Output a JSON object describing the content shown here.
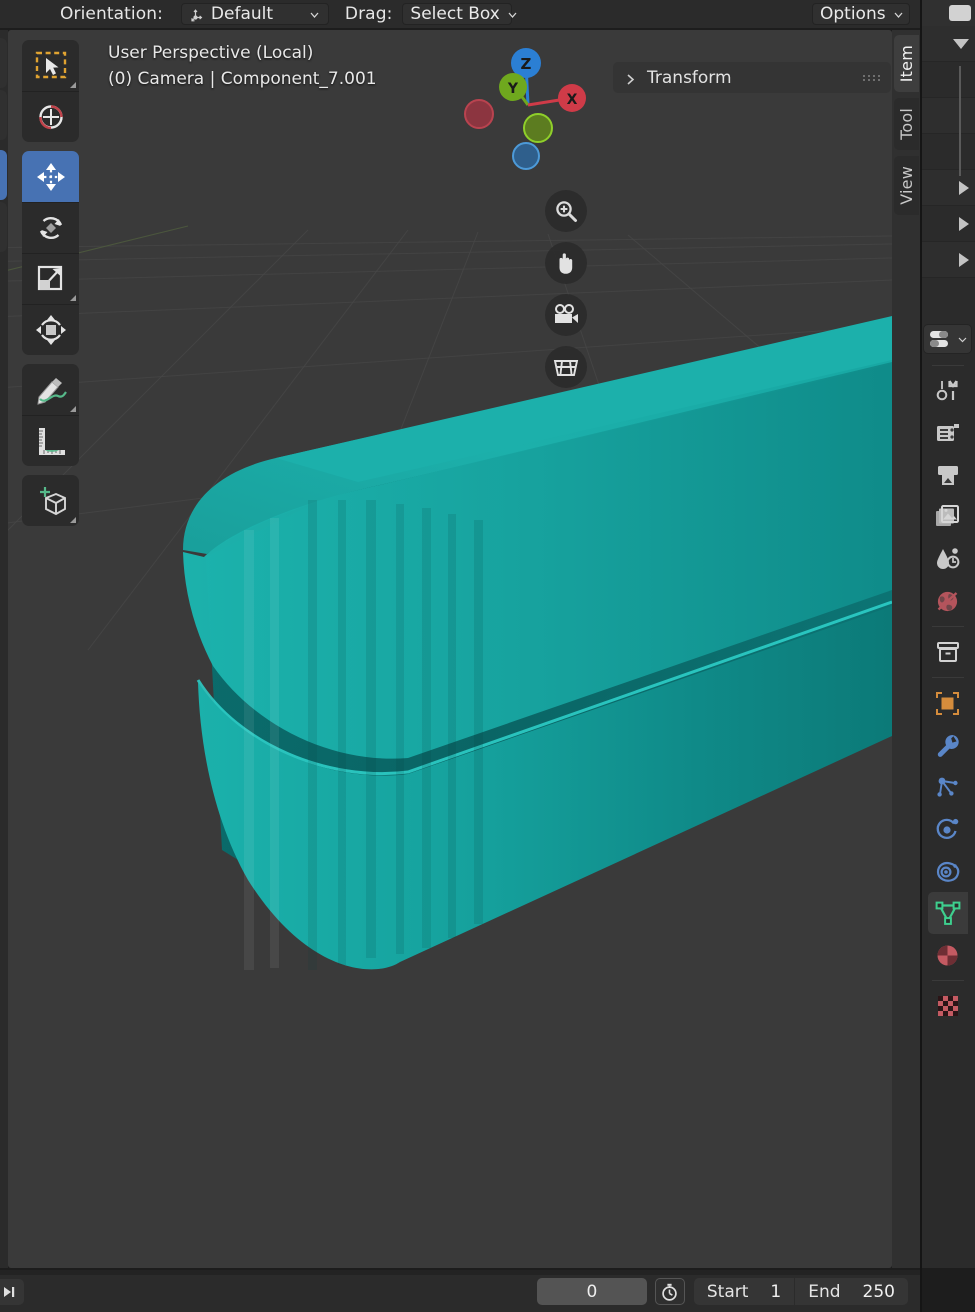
{
  "topbar": {
    "orientation_label": "Orientation:",
    "orientation_value": "Default",
    "drag_label": "Drag:",
    "drag_value": "Select Box",
    "options_label": "Options"
  },
  "viewport": {
    "perspective_text": "User Perspective (Local)",
    "object_text": "(0) Camera | Component_7.001",
    "background_color": "#3a3a3a",
    "object_color_light": "#1aada8",
    "object_color_mid": "#12918e",
    "object_color_dark": "#0c6b6b",
    "object_color_top": "#1cb3ad"
  },
  "toolbar": {
    "groups": [
      {
        "items": [
          {
            "name": "tweak-select-box",
            "label": "Select Box",
            "active": false,
            "has_expand": true
          },
          {
            "name": "cursor",
            "label": "Cursor",
            "active": false,
            "has_expand": false
          }
        ]
      },
      {
        "items": [
          {
            "name": "move",
            "label": "Move",
            "active": true,
            "has_expand": false
          },
          {
            "name": "rotate",
            "label": "Rotate",
            "active": false,
            "has_expand": false
          },
          {
            "name": "scale",
            "label": "Scale",
            "active": false,
            "has_expand": true
          },
          {
            "name": "transform",
            "label": "Transform",
            "active": false,
            "has_expand": false
          }
        ]
      },
      {
        "items": [
          {
            "name": "annotate",
            "label": "Annotate",
            "active": false,
            "has_expand": true
          },
          {
            "name": "measure",
            "label": "Measure",
            "active": false,
            "has_expand": false
          }
        ]
      },
      {
        "items": [
          {
            "name": "add-cube",
            "label": "Add Cube",
            "active": false,
            "has_expand": true
          }
        ]
      }
    ]
  },
  "gizmo": {
    "axes": [
      {
        "label": "Z",
        "color": "#2b7fd4",
        "kind": "positive"
      },
      {
        "label": "Y",
        "color": "#6fa81e",
        "kind": "positive"
      },
      {
        "label": "X",
        "color": "#cf3b48",
        "kind": "positive"
      },
      {
        "label": "",
        "color": "#8c3540",
        "kind": "negative"
      },
      {
        "label": "",
        "color": "#5c7c20",
        "kind": "negative"
      },
      {
        "label": "",
        "color": "#2f5f8c",
        "kind": "negative"
      }
    ]
  },
  "nav_buttons": [
    {
      "name": "zoom-icon",
      "label": "Zoom"
    },
    {
      "name": "hand-icon",
      "label": "Move View"
    },
    {
      "name": "camera-icon",
      "label": "Camera View"
    },
    {
      "name": "grid-icon",
      "label": "Toggle Orthographic"
    }
  ],
  "npanel": {
    "transform_title": "Transform",
    "collapsed": true
  },
  "side_tabs": [
    {
      "label": "Item",
      "active": true
    },
    {
      "label": "Tool",
      "active": false
    },
    {
      "label": "View",
      "active": false
    }
  ],
  "properties_tabs": [
    {
      "name": "tool-properties-tab",
      "color": "#c8c8c8",
      "active": false
    },
    {
      "name": "render-properties-tab",
      "color": "#c8c8c8",
      "active": false
    },
    {
      "name": "output-properties-tab",
      "color": "#c8c8c8",
      "active": false
    },
    {
      "name": "view-layer-properties-tab",
      "color": "#c8c8c8",
      "active": false
    },
    {
      "name": "scene-properties-tab",
      "color": "#c8c8c8",
      "active": false
    },
    {
      "name": "world-properties-tab",
      "color": "#b4545c",
      "active": false
    },
    {
      "name": "collection-properties-tab",
      "color": "#c8c8c8",
      "active": false
    },
    {
      "name": "object-properties-tab",
      "color": "#d58c3c",
      "active": false
    },
    {
      "name": "modifier-properties-tab",
      "color": "#5a86c8",
      "active": false
    },
    {
      "name": "particle-properties-tab",
      "color": "#5a86c8",
      "active": false
    },
    {
      "name": "physics-properties-tab",
      "color": "#5a86c8",
      "active": false
    },
    {
      "name": "constraint-properties-tab",
      "color": "#5a86c8",
      "active": false
    },
    {
      "name": "object-data-properties-tab",
      "color": "#3ecf8e",
      "active": true
    },
    {
      "name": "material-properties-tab",
      "color": "#c45a62",
      "active": false
    },
    {
      "name": "texture-properties-tab",
      "color": "#c45a62",
      "active": false
    }
  ],
  "timeline": {
    "jump_to_end_label": "Jump to Endpoint",
    "current_frame": "0",
    "start_label": "Start",
    "start_value": "1",
    "end_label": "End",
    "end_value": "250"
  }
}
